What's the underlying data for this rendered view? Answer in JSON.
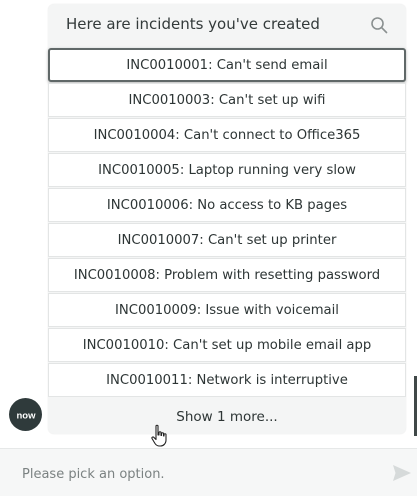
{
  "panel": {
    "title": "Here are incidents you've created",
    "search_icon": "search-icon",
    "show_more_label": "Show 1 more..."
  },
  "incidents": [
    "INC0010001: Can't send email",
    "INC0010003: Can't set up wifi",
    "INC0010004: Can't connect to Office365",
    "INC0010005: Laptop running very slow",
    "INC0010006: No access to KB pages",
    "INC0010007: Can't set up printer",
    "INC0010008: Problem with resetting password",
    "INC0010009: Issue with voicemail",
    "INC0010010: Can't set up mobile email app",
    "INC0010011: Network is interruptive"
  ],
  "avatar": {
    "label": "now"
  },
  "input": {
    "placeholder": "Please pick an option."
  },
  "icons": {
    "send": "send-icon",
    "cursor": "hand-cursor-icon"
  },
  "colors": {
    "avatar_bg": "#2f3a3b",
    "selected_border": "#606868"
  }
}
